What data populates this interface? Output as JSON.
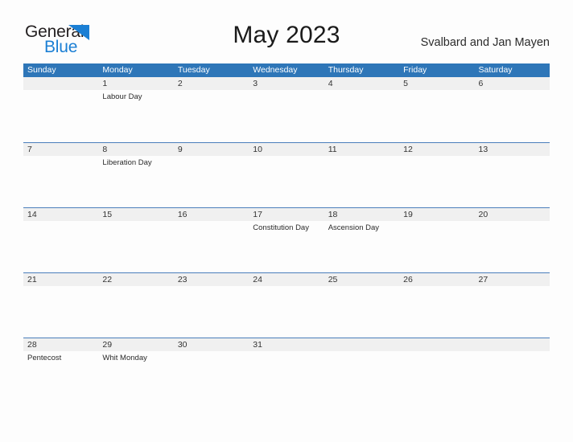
{
  "brand": {
    "name_part1": "General",
    "name_part2": "Blue",
    "flag_icon": "blue-triangle-flag-icon",
    "accent_color": "#1b7fd4"
  },
  "header": {
    "title": "May 2023",
    "region": "Svalbard and Jan Mayen"
  },
  "theme": {
    "header_blue": "#2e76b8",
    "band_gray": "#f0f0f0",
    "separator": "#4a7ebb"
  },
  "calendar": {
    "weekday_headers": [
      "Sunday",
      "Monday",
      "Tuesday",
      "Wednesday",
      "Thursday",
      "Friday",
      "Saturday"
    ],
    "weeks": [
      [
        {
          "num": "",
          "event": ""
        },
        {
          "num": "1",
          "event": "Labour Day"
        },
        {
          "num": "2",
          "event": ""
        },
        {
          "num": "3",
          "event": ""
        },
        {
          "num": "4",
          "event": ""
        },
        {
          "num": "5",
          "event": ""
        },
        {
          "num": "6",
          "event": ""
        }
      ],
      [
        {
          "num": "7",
          "event": ""
        },
        {
          "num": "8",
          "event": "Liberation Day"
        },
        {
          "num": "9",
          "event": ""
        },
        {
          "num": "10",
          "event": ""
        },
        {
          "num": "11",
          "event": ""
        },
        {
          "num": "12",
          "event": ""
        },
        {
          "num": "13",
          "event": ""
        }
      ],
      [
        {
          "num": "14",
          "event": ""
        },
        {
          "num": "15",
          "event": ""
        },
        {
          "num": "16",
          "event": ""
        },
        {
          "num": "17",
          "event": "Constitution Day"
        },
        {
          "num": "18",
          "event": "Ascension Day"
        },
        {
          "num": "19",
          "event": ""
        },
        {
          "num": "20",
          "event": ""
        }
      ],
      [
        {
          "num": "21",
          "event": ""
        },
        {
          "num": "22",
          "event": ""
        },
        {
          "num": "23",
          "event": ""
        },
        {
          "num": "24",
          "event": ""
        },
        {
          "num": "25",
          "event": ""
        },
        {
          "num": "26",
          "event": ""
        },
        {
          "num": "27",
          "event": ""
        }
      ],
      [
        {
          "num": "28",
          "event": "Pentecost"
        },
        {
          "num": "29",
          "event": "Whit Monday"
        },
        {
          "num": "30",
          "event": ""
        },
        {
          "num": "31",
          "event": ""
        },
        {
          "num": "",
          "event": ""
        },
        {
          "num": "",
          "event": ""
        },
        {
          "num": "",
          "event": ""
        }
      ]
    ]
  }
}
